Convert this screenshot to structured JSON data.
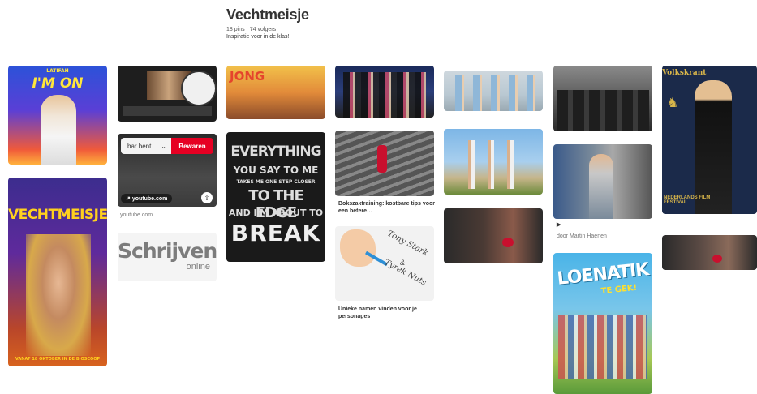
{
  "board": {
    "title": "Vechtmeisje",
    "meta": "18 pins · 74 volgers",
    "description": "Inspiratie voor in de klas!"
  },
  "pins": {
    "imon": {
      "artist": "LATIFAH",
      "title": "I'M ON"
    },
    "poster": {
      "title": "VECHTMEISJE",
      "release": "VANAF 18 OKTOBER IN DE BIOSCOOP"
    },
    "editor": {},
    "youtube": {
      "board_select": "bar bent",
      "save_label": "Bewaren",
      "link": "youtube.com",
      "caption": "youtube.com"
    },
    "schrijven": {
      "line1": "Schrijven",
      "line2": "online"
    },
    "jong": {
      "logo": "JONG"
    },
    "quote": {
      "line1": "EVERYTHING",
      "line2": "YOU SAY TO ME",
      "line3": "TAKES ME ONE STEP CLOSER",
      "line4": "TO THE EDGE",
      "line5": "AND I'M ABOUT TO",
      "line6": "BREAK"
    },
    "cast": {},
    "boks": {
      "caption": "Bokszaktraining: kostbare tips voor een betere…"
    },
    "namen": {
      "caption": "Unieke namen vinden voor je personages",
      "hand1": "Tony Stark",
      "hand2": "&",
      "hand3": "Tyrek Nuts"
    },
    "kids": {},
    "beach": {},
    "boxers": {},
    "room": {},
    "guitar": {
      "play": "▶",
      "caption": "door Martin Haenen"
    },
    "loenatik": {
      "title": "LOENATIK",
      "subtitle": "TE GEK!"
    },
    "volkskrant": {
      "brand": "Volkskrant",
      "festival": "NEDERLANDS FILM FESTIVAL"
    },
    "boxers2": {}
  },
  "colors": {
    "save": "#e60023",
    "text": "#333333"
  }
}
